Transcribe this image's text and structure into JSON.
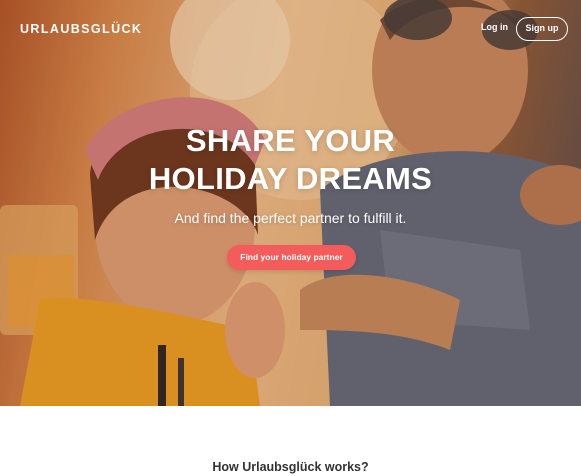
{
  "header": {
    "logo": "URLAUBSGLÜCK",
    "login_label": "Log in",
    "signup_label": "Sign up"
  },
  "hero": {
    "headline_line1": "SHARE YOUR",
    "headline_line2": "HOLIDAY DREAMS",
    "subheadline": "And find the perfect partner to fulfill it.",
    "cta_label": "Find your holiday partner",
    "colors": {
      "cta": "#f45b5b",
      "text": "#ffffff"
    }
  },
  "section": {
    "title": "How Urlaubsglück works?"
  }
}
